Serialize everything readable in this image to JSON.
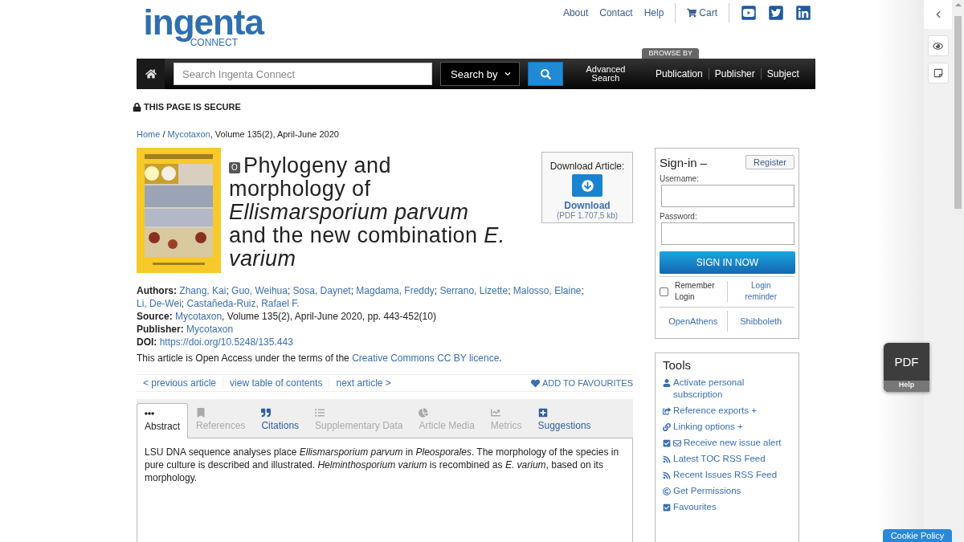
{
  "header": {
    "logo_word": "ingenta",
    "logo_sub": "CONNECT",
    "top_links": [
      "About",
      "Contact",
      "Help"
    ],
    "cart": "Cart"
  },
  "nav": {
    "search_placeholder": "Search Ingenta Connect",
    "search_by": "Search by",
    "advanced": "Advanced Search",
    "browse_label": "BROWSE BY",
    "browse": [
      "Publication",
      "Publisher",
      "Subject"
    ]
  },
  "secure": "THIS PAGE IS SECURE",
  "breadcrumb": {
    "home": "Home",
    "separator": "/",
    "journal": "Mycotaxon",
    "rest": ", Volume 135(2), April-June 2020"
  },
  "article": {
    "access_badge": "O",
    "title": "Phylogeny and morphology of *Ellismarsporium parvum* and the new combination *E. varium*"
  },
  "download": {
    "label": "Download Article:",
    "button": "Download",
    "size": "(PDF 1.707,5 kb)"
  },
  "meta": {
    "authors_label": "Authors:",
    "authors": [
      "Zhang, Kai",
      "Guo, Weihua",
      "Sosa, Daynet",
      "Magdama, Freddy",
      "Serrano, Lizette",
      "Malosso, Elaine",
      "Li, De-Wei",
      "Castañeda-Ruiz, Rafael F."
    ],
    "authors_separator": ";",
    "source_label": "Source:",
    "source_link": "Mycotaxon",
    "source_rest": ", Volume 135(2), April-June 2020, pp. 443-452(10)",
    "publisher_label": "Publisher:",
    "publisher": "Mycotaxon",
    "doi_label": "DOI:",
    "doi": "https://doi.org/10.5248/135.443",
    "license_text": "This article is Open Access under the terms of the ",
    "license_link": "Creative Commons CC BY licence",
    "license_end": "."
  },
  "article_nav": {
    "links": [
      "< previous article",
      "view table of contents",
      "next article >"
    ],
    "favourites": "ADD TO FAVOURITES"
  },
  "tabs": [
    {
      "kind": "dots",
      "label": "Abstract",
      "selected": true,
      "disabled": false
    },
    {
      "kind": "bookmark",
      "label": "References",
      "selected": false,
      "disabled": true
    },
    {
      "kind": "quote",
      "label": "Citations",
      "selected": false,
      "disabled": false
    },
    {
      "kind": "list",
      "label": "Supplementary Data",
      "selected": false,
      "disabled": true
    },
    {
      "kind": "pie",
      "label": "Article Media",
      "selected": false,
      "disabled": true
    },
    {
      "kind": "chart",
      "label": "Metrics",
      "selected": false,
      "disabled": true
    },
    {
      "kind": "plus",
      "label": "Suggestions",
      "selected": false,
      "disabled": false
    }
  ],
  "abstract": "LSU DNA sequence analyses place *Ellismarsporium parvum* in *Pleosporales*. The morphology of the species in pure culture is described and illustrated. *Helminthosporium varium* is recombined as *E. varium*, based on its morphology.",
  "signin": {
    "title": "Sign-in –",
    "register": "Register",
    "username_label": "Username:",
    "password_label": "Password:",
    "submit": "SIGN IN NOW",
    "remember": "Remember Login",
    "remember_checked": false,
    "reminder": "Login reminder",
    "institutional": [
      "OpenAthens",
      "Shibboleth"
    ]
  },
  "tools": {
    "title": "Tools",
    "items": [
      {
        "kind": "user",
        "label": "Activate personal subscription"
      },
      {
        "kind": "export",
        "label": "Reference exports +"
      },
      {
        "kind": "link",
        "label": "Linking options +"
      },
      {
        "kind": "alert",
        "label": "Receive new issue alert"
      },
      {
        "kind": "rss",
        "label": "Latest TOC RSS Feed"
      },
      {
        "kind": "rss",
        "label": "Recent Issues RSS Feed"
      },
      {
        "kind": "copyright",
        "label": "Get Permissions"
      },
      {
        "kind": "check",
        "label": "Favourites"
      }
    ]
  },
  "pdf_widget": {
    "label": "PDF",
    "help": "Help"
  },
  "cookie": "Cookie Policy"
}
